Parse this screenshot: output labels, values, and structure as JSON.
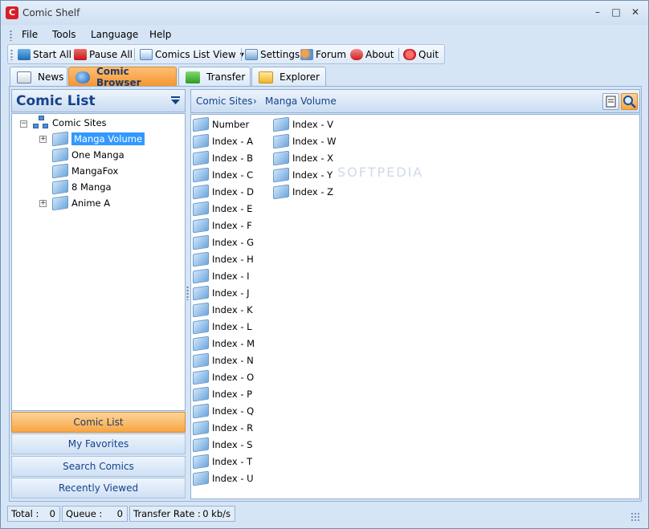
{
  "window": {
    "title": "Comic Shelf",
    "app_icon_letter": "C",
    "minimize": "–",
    "maximize": "□",
    "close": "✕"
  },
  "menu": [
    "File",
    "Tools",
    "Language",
    "Help"
  ],
  "toolbar": {
    "start_all": "Start All",
    "pause_all": "Pause All",
    "comics_list_view": "Comics List View",
    "dropdown_arrow": "▾",
    "settings": "Settings",
    "forum": "Forum",
    "about": "About",
    "quit": "Quit"
  },
  "tabs": [
    {
      "label": "News",
      "active": false
    },
    {
      "label": "Comic Browser",
      "active": true
    },
    {
      "label": "Transfer",
      "active": false
    },
    {
      "label": "Explorer",
      "active": false
    }
  ],
  "left_panel": {
    "title": "Comic List",
    "tree": {
      "root": "Comic Sites",
      "root_expander": "−",
      "children": [
        {
          "label": "Manga Volume",
          "expander": "+",
          "selected": true
        },
        {
          "label": "One Manga",
          "expander": "",
          "selected": false
        },
        {
          "label": "MangaFox",
          "expander": "",
          "selected": false
        },
        {
          "label": "8 Manga",
          "expander": "",
          "selected": false
        },
        {
          "label": "Anime A",
          "expander": "+",
          "selected": false
        }
      ]
    },
    "nav_buttons": [
      {
        "label": "Comic List",
        "active": true
      },
      {
        "label": "My Favorites",
        "active": false
      },
      {
        "label": "Search Comics",
        "active": false
      },
      {
        "label": "Recently Viewed",
        "active": false
      }
    ]
  },
  "right_panel": {
    "breadcrumb": [
      "Comic Sites",
      "Manga Volume"
    ],
    "breadcrumb_separator": "›",
    "items_col1": [
      "Number",
      "Index - A",
      "Index - B",
      "Index - C",
      "Index - D",
      "Index - E",
      "Index - F",
      "Index - G",
      "Index - H",
      "Index - I",
      "Index - J",
      "Index - K",
      "Index - L",
      "Index - M",
      "Index - N",
      "Index - O",
      "Index - P",
      "Index - Q",
      "Index - R",
      "Index - S",
      "Index - T",
      "Index - U"
    ],
    "items_col2": [
      "Index - V",
      "Index - W",
      "Index - X",
      "Index - Y",
      "Index - Z"
    ]
  },
  "watermark": "SOFTPEDIA",
  "status": {
    "total_label": "Total :",
    "total_value": "0",
    "queue_label": "Queue :",
    "queue_value": "0",
    "rate_label": "Transfer Rate :",
    "rate_value": "0 kb/s"
  },
  "colors": {
    "accent_orange": "#f69431",
    "selection_blue": "#3399ff",
    "header_text": "#15428b"
  }
}
